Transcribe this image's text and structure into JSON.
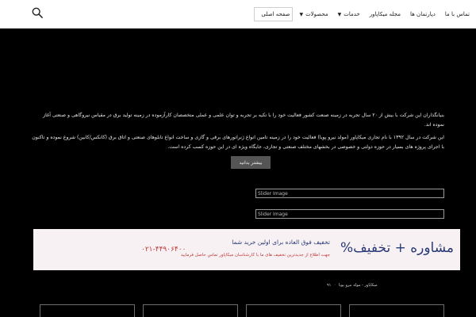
{
  "header": {
    "nav": [
      {
        "label": "صفحه اصلی",
        "caret": false
      },
      {
        "label": "محصولات",
        "caret": true
      },
      {
        "label": "خدمات",
        "caret": true
      },
      {
        "label": "مجله میکاپاور",
        "caret": false
      },
      {
        "label": "دپارتمان ها",
        "caret": false
      },
      {
        "label": "تماس با ما",
        "caret": false
      }
    ],
    "search_icon": "search-icon"
  },
  "intro": {
    "paragraph1": "بنیانگذاران این شرکت با بیش از ۲۰ سال تجربه در زمینه صنعت کشور فعالیت خود را با تکیه بر تجربه و توان علمی و عملی متخصصان کارآزموده در زمینه تولید برق در مقیاس نیروگاهی و صنعتی آغاز نموده اند.",
    "paragraph2": "این شرکت در سال ۱۳۹۲ با نام تجاری میکاپاور (مولد نیرو پویا) فعالیت خود را در زمینه تامین انواع ژنراتورهای برقی و گازی و ساخت انواع تابلوهای صنعتی و اتاق برق (کانکس/کابین) شروع نموده و تاکنون با اجرای پروژه های بسیار در حوزه دولتی و خصوصی در بخشهای مختلف صنعتی و تجاری، جایگاه ویژه ای در این حوزه کسب کرده است.",
    "cta_label": "بیشتر بدانید"
  },
  "images": [
    {
      "alt": "Slider Image"
    },
    {
      "alt": "Slider Image"
    }
  ],
  "banner": {
    "title": "مشاوره + تخفیف%",
    "line1": "تخفیف فوق العاده برای اولین خرید شما",
    "line2": "جهت اطلاع از جدیدترین تخفیف های ما با کارشناسان میکاپاور تماس حاصل فرمایید",
    "phone": "۰۲۱-۴۴۹۰۶۴۰۰",
    "colors": {
      "accent": "#2a3a78",
      "highlight": "#c23a3a",
      "background": "#f7f1f3"
    }
  },
  "links": {
    "link1": "میکاپاور - مولد نیرو پویا",
    "link2": "۹۱"
  }
}
